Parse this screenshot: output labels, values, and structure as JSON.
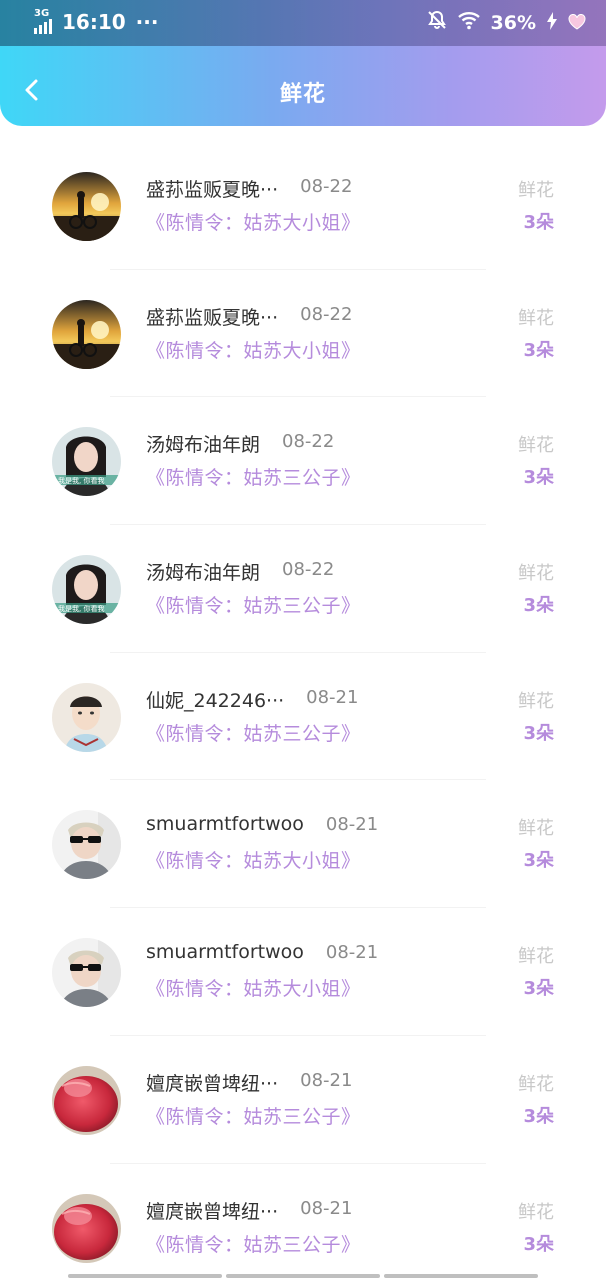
{
  "status_bar": {
    "network": "3G",
    "time": "16:10",
    "battery": "36%",
    "icons": [
      "signal-icon",
      "bell-off-icon",
      "wifi-icon",
      "charging-icon",
      "heart-icon"
    ]
  },
  "header": {
    "title": "鲜花",
    "back_icon": "chevron-left-icon",
    "gradient": [
      "#3fd7f7",
      "#c49bec"
    ]
  },
  "colors": {
    "accent": "#b58bdc",
    "muted": "#c8c8c8",
    "name": "#333333"
  },
  "records": [
    {
      "user": "盛荪监贩夏晚···",
      "date": "08-22",
      "drama": "《陈情令：姑苏大小姐》",
      "gift": "鲜花",
      "count": "3朵",
      "avatar": "sunset-avatar"
    },
    {
      "user": "盛荪监贩夏晚···",
      "date": "08-22",
      "drama": "《陈情令：姑苏大小姐》",
      "gift": "鲜花",
      "count": "3朵",
      "avatar": "sunset-avatar"
    },
    {
      "user": "汤姆布油年朗",
      "date": "08-22",
      "drama": "《陈情令：姑苏三公子》",
      "gift": "鲜花",
      "count": "3朵",
      "avatar": "woman-avatar"
    },
    {
      "user": "汤姆布油年朗",
      "date": "08-22",
      "drama": "《陈情令：姑苏三公子》",
      "gift": "鲜花",
      "count": "3朵",
      "avatar": "woman-avatar"
    },
    {
      "user": "仙妮_242246···",
      "date": "08-21",
      "drama": "《陈情令：姑苏三公子》",
      "gift": "鲜花",
      "count": "3朵",
      "avatar": "selfie-avatar"
    },
    {
      "user": "smuarmtfortwoo",
      "date": "08-21",
      "drama": "《陈情令：姑苏大小姐》",
      "gift": "鲜花",
      "count": "3朵",
      "avatar": "sunglasses-avatar"
    },
    {
      "user": "smuarmtfortwoo",
      "date": "08-21",
      "drama": "《陈情令：姑苏大小姐》",
      "gift": "鲜花",
      "count": "3朵",
      "avatar": "sunglasses-avatar"
    },
    {
      "user": "嬗庹嵌曾埤纽···",
      "date": "08-21",
      "drama": "《陈情令：姑苏三公子》",
      "gift": "鲜花",
      "count": "3朵",
      "avatar": "red-fruit-avatar"
    },
    {
      "user": "嬗庹嵌曾埤纽···",
      "date": "08-21",
      "drama": "《陈情令：姑苏三公子》",
      "gift": "鲜花",
      "count": "3朵",
      "avatar": "red-fruit-avatar"
    }
  ]
}
